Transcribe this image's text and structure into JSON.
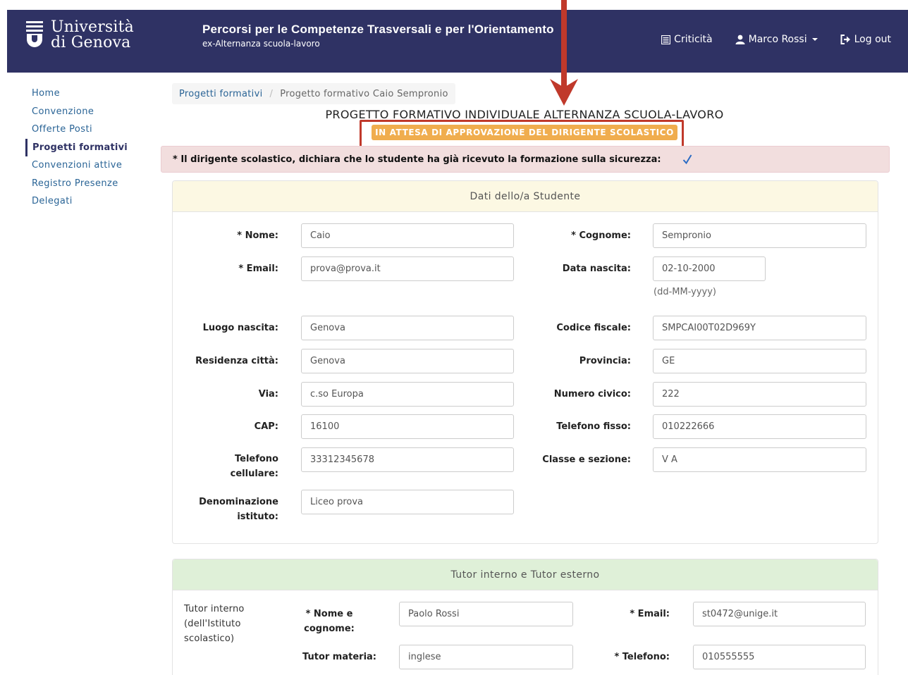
{
  "header": {
    "brand_line1": "Università",
    "brand_line2": "di Genova",
    "title": "Percorsi per le Competenze Trasversali e per l'Orientamento",
    "subtitle": "ex-Alternanza scuola-lavoro",
    "nav": {
      "criticita": "Criticità",
      "user": "Marco Rossi",
      "logout": "Log out"
    },
    "colors": {
      "navbar": "#2f3264"
    }
  },
  "sidebar": {
    "items": [
      {
        "label": "Home"
      },
      {
        "label": "Convenzione"
      },
      {
        "label": "Offerte Posti"
      },
      {
        "label": "Progetti formativi"
      },
      {
        "label": "Convenzioni attive"
      },
      {
        "label": "Registro Presenze"
      },
      {
        "label": "Delegati"
      }
    ],
    "active": "Progetti formativi"
  },
  "breadcrumb": {
    "parent": "Progetti formativi",
    "current": "Progetto formativo Caio Sempronio"
  },
  "page": {
    "heading": "PROGETTO FORMATIVO INDIVIDUALE ALTERNANZA SCUOLA-LAVORO",
    "status": "IN ATTESA DI APPROVAZIONE DEL DIRIGENTE SCOLASTICO",
    "status_color": "#f0ad4e",
    "annotation_color": "#c0392b",
    "alert": "* Il dirigente scolastico, dichiara che lo studente ha già ricevuto la formazione sulla sicurezza:",
    "alert_checked": true
  },
  "student": {
    "heading": "Dati dello/a Studente",
    "fields": {
      "nome": {
        "label": "* Nome:",
        "value": "Caio"
      },
      "cognome": {
        "label": "* Cognome:",
        "value": "Sempronio"
      },
      "email": {
        "label": "* Email:",
        "value": "prova@prova.it"
      },
      "data_nascita": {
        "label": "Data nascita:",
        "value": "02-10-2000",
        "hint": "(dd-MM-yyyy)"
      },
      "luogo_nascita": {
        "label": "Luogo nascita:",
        "value": "Genova"
      },
      "codice_fiscale": {
        "label": "Codice fiscale:",
        "value": "SMPCAI00T02D969Y"
      },
      "residenza": {
        "label": "Residenza città:",
        "value": "Genova"
      },
      "provincia": {
        "label": "Provincia:",
        "value": "GE"
      },
      "via": {
        "label": "Via:",
        "value": "c.so Europa"
      },
      "numero_civico": {
        "label": "Numero civico:",
        "value": "222"
      },
      "cap": {
        "label": "CAP:",
        "value": "16100"
      },
      "telefono_fisso": {
        "label": "Telefono fisso:",
        "value": "010222666"
      },
      "telefono_cellulare": {
        "label_l1": "Telefono",
        "label_l2": "cellulare:",
        "value": "33312345678"
      },
      "classe": {
        "label": "Classe e sezione:",
        "value": "V A"
      },
      "istituto": {
        "label_l1": "Denominazione",
        "label_l2": "istituto:",
        "value": "Liceo prova"
      }
    }
  },
  "tutor": {
    "heading": "Tutor interno e Tutor esterno",
    "section_label_l1": "Tutor interno",
    "section_label_l2": "(dell'Istituto",
    "section_label_l3": "scolastico)",
    "fields": {
      "nome": {
        "label_l1": "* Nome e",
        "label_l2": "cognome:",
        "value": "Paolo Rossi"
      },
      "email": {
        "label": "* Email:",
        "value": "st0472@unige.it"
      },
      "materia": {
        "label": "Tutor materia:",
        "value": "inglese"
      },
      "telefono": {
        "label": "* Telefono:",
        "value": "010555555"
      }
    }
  }
}
